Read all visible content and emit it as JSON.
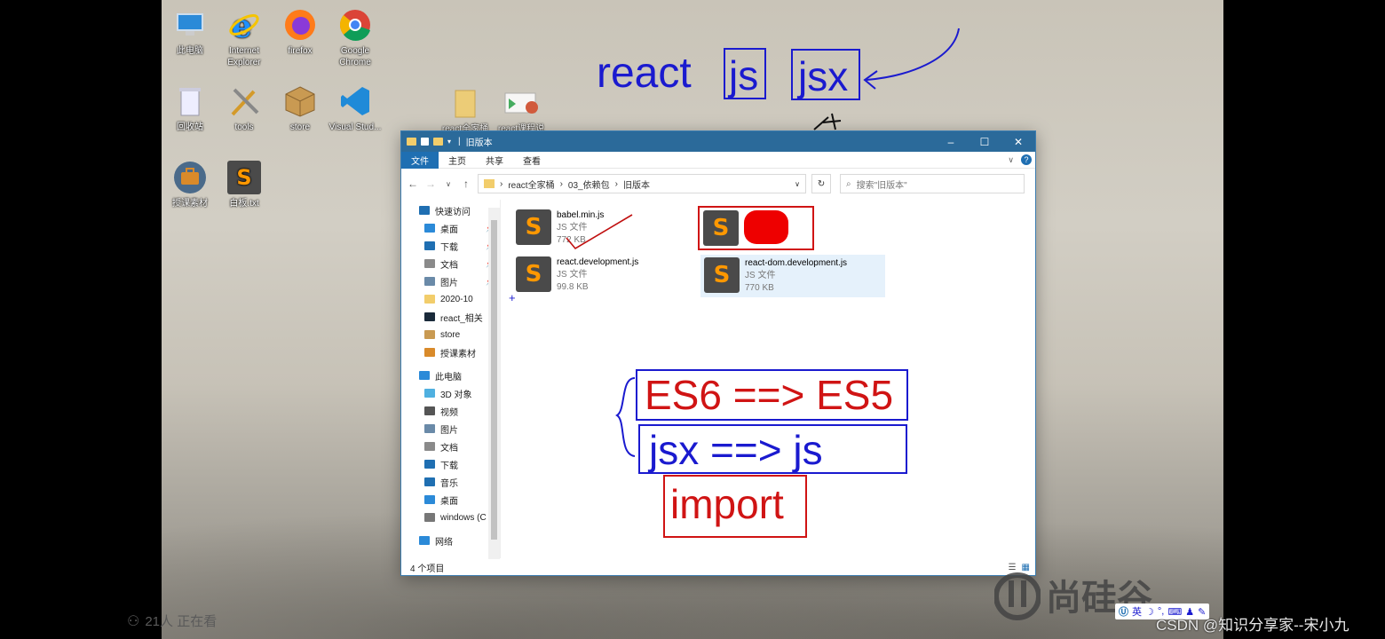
{
  "desktop_icons": [
    {
      "label": "此电脑",
      "icon": "pc-icon"
    },
    {
      "label": "Internet Explorer",
      "icon": "ie-icon"
    },
    {
      "label": "firefox",
      "icon": "firefox-icon"
    },
    {
      "label": "Google Chrome",
      "icon": "chrome-icon"
    },
    {
      "label": "回收站",
      "icon": "recycle-bin-icon"
    },
    {
      "label": "tools",
      "icon": "tools-icon"
    },
    {
      "label": "store",
      "icon": "box-icon"
    },
    {
      "label": "Visual Stud...",
      "icon": "vscode-icon"
    },
    {
      "label": "授课素材",
      "icon": "briefcase-icon"
    },
    {
      "label": "白板.txt",
      "icon": "sublime-icon"
    },
    {
      "label": "react全家桶",
      "icon": "folder-icon"
    },
    {
      "label": "react课程说",
      "icon": "ppt-icon"
    }
  ],
  "window": {
    "title": "旧版本",
    "tabs": [
      "文件",
      "主页",
      "共享",
      "查看"
    ],
    "breadcrumb": [
      "react全家桶",
      "03_依赖包",
      "旧版本"
    ],
    "search_placeholder": "搜索\"旧版本\"",
    "sidebar": [
      {
        "label": "快速访问",
        "icon": "star-icon",
        "top": true
      },
      {
        "label": "桌面",
        "icon": "desktop-icon",
        "pin": true
      },
      {
        "label": "下载",
        "icon": "download-icon",
        "pin": true
      },
      {
        "label": "文档",
        "icon": "document-icon",
        "pin": true
      },
      {
        "label": "图片",
        "icon": "picture-icon",
        "pin": true
      },
      {
        "label": "2020-10",
        "icon": "folder-icon"
      },
      {
        "label": "react_相关",
        "icon": "react-icon"
      },
      {
        "label": "store",
        "icon": "box-icon"
      },
      {
        "label": "授课素材",
        "icon": "briefcase-icon"
      },
      {
        "label": "此电脑",
        "icon": "pc-icon",
        "top": true
      },
      {
        "label": "3D 对象",
        "icon": "cube-icon"
      },
      {
        "label": "视频",
        "icon": "video-icon"
      },
      {
        "label": "图片",
        "icon": "picture-icon"
      },
      {
        "label": "文档",
        "icon": "document-icon"
      },
      {
        "label": "下载",
        "icon": "download-icon"
      },
      {
        "label": "音乐",
        "icon": "music-icon"
      },
      {
        "label": "桌面",
        "icon": "desktop-icon"
      },
      {
        "label": "windows (C",
        "icon": "drive-icon"
      },
      {
        "label": "网络",
        "icon": "network-icon",
        "top": true
      }
    ],
    "files": [
      {
        "name": "babel.min.js",
        "type": "JS 文件",
        "size": "772 KB"
      },
      {
        "name": "",
        "type": "",
        "size": ""
      },
      {
        "name": "react.development.js",
        "type": "JS 文件",
        "size": "99.8 KB"
      },
      {
        "name": "react-dom.development.js",
        "type": "JS 文件",
        "size": "770 KB"
      }
    ],
    "status": "4 个项目"
  },
  "annotations": {
    "react": "react",
    "js": "js",
    "jsx": "jsx",
    "es": "ES6 ==> ES5",
    "jsx_js": "jsx ==> js",
    "import": "import"
  },
  "overlay": {
    "viewers": "21人 正在看",
    "watermark_logo": "尚硅谷",
    "credit": "CSDN @知识分享家--宋小九",
    "ime": "英"
  },
  "colors": {
    "title_bar": "#2b6a9a",
    "ink_blue": "#1a1acf",
    "ink_red": "#d01414"
  }
}
